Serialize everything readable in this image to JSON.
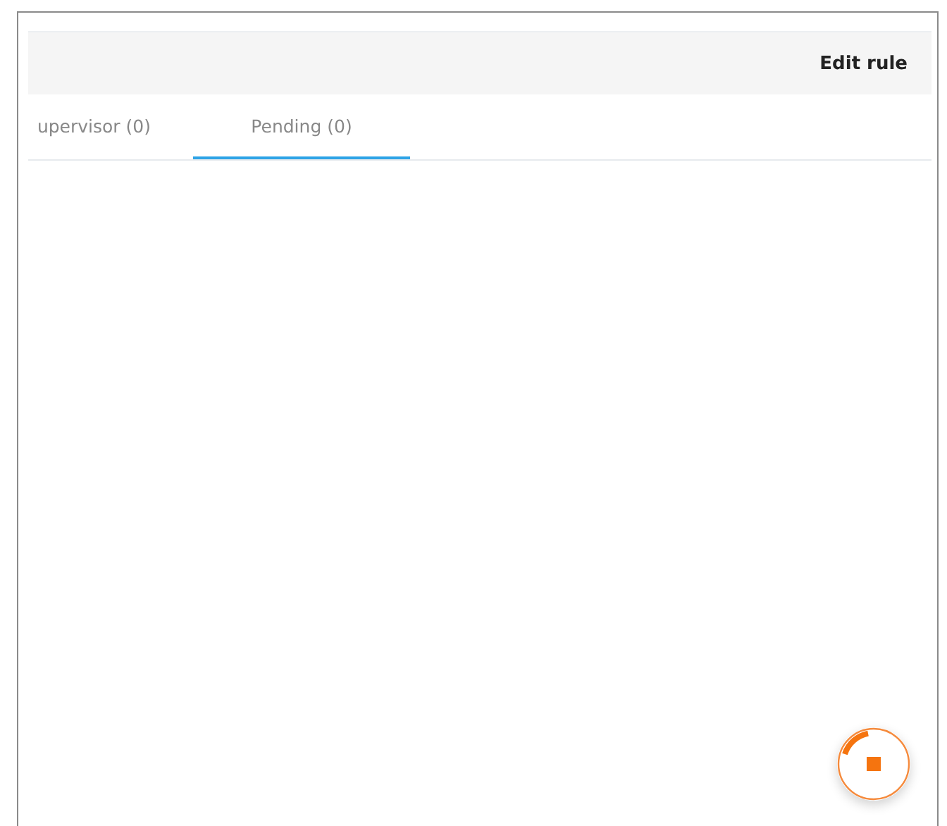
{
  "header": {
    "action": "Edit rule"
  },
  "tabs": [
    {
      "label": "upervisor (0)",
      "selected": false
    },
    {
      "label": "Pending (0)",
      "selected": true
    }
  ]
}
